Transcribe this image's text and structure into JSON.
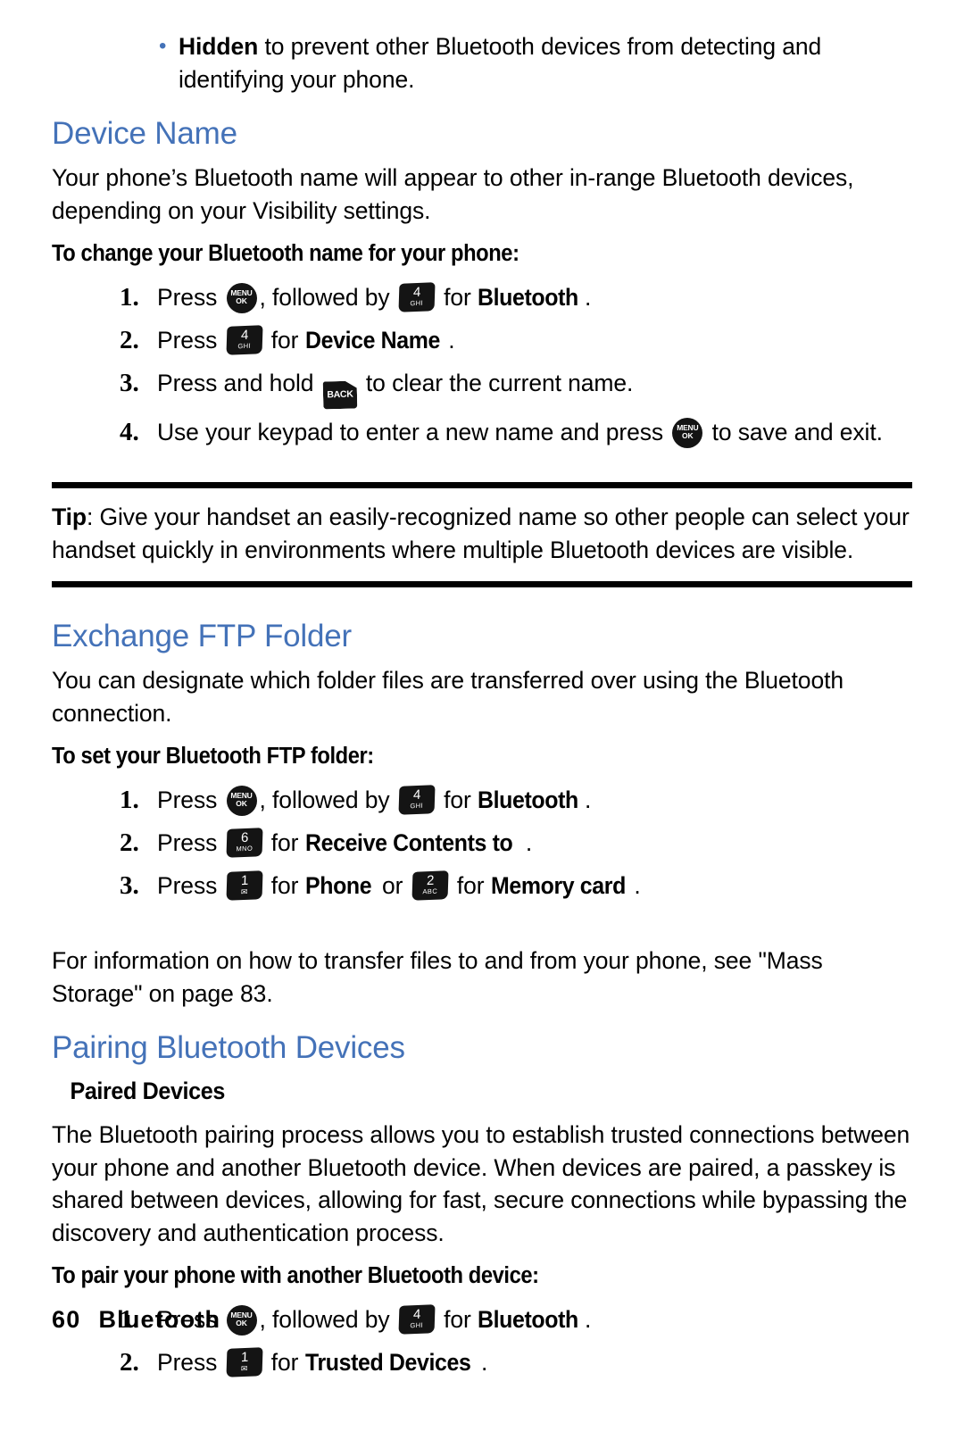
{
  "document": {
    "accent_blue": "#4472b8",
    "footer": {
      "page_number": "60",
      "section": "Bluetooth"
    }
  },
  "bullet": {
    "term": "Hidden",
    "rest": " to prevent other Bluetooth devices from detecting and identifying your phone."
  },
  "device_name": {
    "heading": "Device Name",
    "intro": "Your phone’s Bluetooth name will appear to other in-range Bluetooth devices, depending on your Visibility settings.",
    "task_heading": "To change your Bluetooth name for your phone:",
    "steps": [
      {
        "num": "1.",
        "pre": "Press",
        "keys": [
          {
            "type": "menu",
            "line1": "MENU",
            "line2": "OK"
          }
        ],
        "mid": ", followed by",
        "key2": {
          "type": "num",
          "digit": "4",
          "sub": "GHI"
        },
        "post_plain": "for",
        "post_bold": "Bluetooth",
        "tail": "."
      },
      {
        "num": "2.",
        "pre": "Press",
        "key2": {
          "type": "num",
          "digit": "4",
          "sub": "GHI"
        },
        "post_plain": "for",
        "post_bold": "Device Name",
        "tail": "."
      },
      {
        "num": "3.",
        "pre": "Press and hold",
        "key2": {
          "type": "back",
          "label": "BACK"
        },
        "post_plain": "to clear the current name.",
        "post_bold": "",
        "tail": ""
      },
      {
        "num": "4.",
        "pre": "Use your keypad to enter a new name and press",
        "key2": {
          "type": "menu",
          "line1": "MENU",
          "line2": "OK"
        },
        "post_plain": "to save and exit.",
        "post_bold": "",
        "tail": ""
      }
    ]
  },
  "tip": {
    "label": "Tip",
    "text": ": Give your handset an easily-recognized name so other people can select your handset quickly in environments where multiple Bluetooth devices are visible."
  },
  "exchange_ftp": {
    "heading": "Exchange FTP Folder",
    "intro": "You can designate which folder files are transferred over using the Bluetooth connection.",
    "task_heading": "To set your Bluetooth FTP folder:",
    "steps": [
      {
        "num": "1.",
        "pre": "Press",
        "mid": ", followed by",
        "post_plain": "for",
        "post_bold": "Bluetooth",
        "tail": "."
      },
      {
        "num": "2.",
        "pre": "Press",
        "key2": {
          "type": "num",
          "digit": "6",
          "sub": "MNO"
        },
        "post_plain": "for",
        "post_bold": "Receive Contents to",
        "tail": "."
      },
      {
        "num": "3.",
        "pre": "Press",
        "key2": {
          "type": "num",
          "digit": "1",
          "sub": "envelope"
        },
        "post_plain": "for",
        "post_bold": "Phone",
        "mid2": "or",
        "key3": {
          "type": "num",
          "digit": "2",
          "sub": "ABC"
        },
        "post_plain2": "for",
        "post_bold2": "Memory card",
        "tail": "."
      }
    ],
    "note": "For information on how to transfer files to and from your phone, see \"Mass Storage\" on page 83."
  },
  "pairing": {
    "heading": "Pairing Bluetooth Devices",
    "subheading": "Paired Devices",
    "body": "The Bluetooth pairing process allows you to establish trusted connections between your phone and another Bluetooth device. When devices are paired, a passkey is shared between devices, allowing for fast, secure connections while bypassing the discovery and authentication process.",
    "task_heading": "To pair your phone with another Bluetooth device:",
    "steps": [
      {
        "num": "1.",
        "pre": "Press",
        "mid": ", followed by",
        "post_plain": "for",
        "post_bold": "Bluetooth",
        "tail": "."
      },
      {
        "num": "2.",
        "pre": "Press",
        "key2": {
          "type": "num",
          "digit": "1",
          "sub": "envelope"
        },
        "post_plain": "for",
        "post_bold": "Trusted Devices",
        "tail": "."
      }
    ]
  },
  "keys": {
    "menu_line1": "MENU",
    "menu_line2": "OK",
    "back_label": "BACK",
    "k1_digit": "1",
    "k2_digit": "2",
    "k2_sub": "ABC",
    "k4_digit": "4",
    "k4_sub": "GHI",
    "k6_digit": "6",
    "k6_sub": "MNO",
    "envelope_glyph": "✉"
  }
}
